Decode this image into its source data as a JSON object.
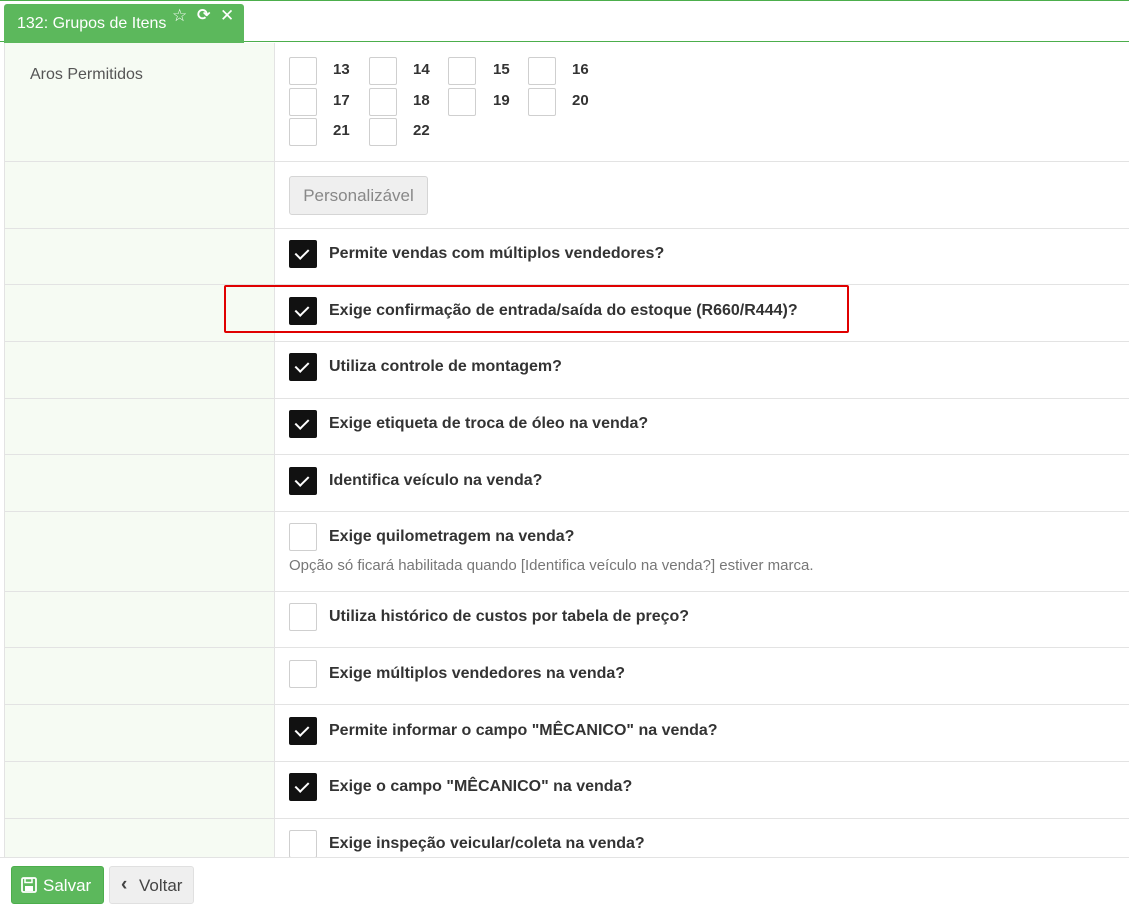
{
  "tab": {
    "title": "132: Grupos de Itens",
    "star_icon": "star-icon",
    "refresh_icon": "refresh-icon",
    "close_icon": "close-icon",
    "color": "#5cb85c"
  },
  "aros": {
    "label": "Aros Permitidos",
    "items": [
      {
        "value": "13",
        "checked": false
      },
      {
        "value": "14",
        "checked": false
      },
      {
        "value": "15",
        "checked": false
      },
      {
        "value": "16",
        "checked": false
      },
      {
        "value": "17",
        "checked": false
      },
      {
        "value": "18",
        "checked": false
      },
      {
        "value": "19",
        "checked": false
      },
      {
        "value": "20",
        "checked": false
      },
      {
        "value": "21",
        "checked": false
      },
      {
        "value": "22",
        "checked": false
      }
    ]
  },
  "personalizavel_button": "Personalizável",
  "options": [
    {
      "label": "Permite vendas com múltiplos vendedores?",
      "checked": true
    },
    {
      "label": "Exige confirmação de entrada/saída do estoque (R660/R444)?",
      "checked": true,
      "highlighted": true
    },
    {
      "label": "Utiliza controle de montagem?",
      "checked": true
    },
    {
      "label": "Exige etiqueta de troca de óleo na venda?",
      "checked": true
    },
    {
      "label": "Identifica veículo na venda?",
      "checked": true
    },
    {
      "label": "Exige quilometragem na venda?",
      "checked": false,
      "hint": "Opção só ficará habilitada quando [Identifica veículo na venda?] estiver marca."
    },
    {
      "label": "Utiliza histórico de custos por tabela de preço?",
      "checked": false
    },
    {
      "label": "Exige múltiplos vendedores na venda?",
      "checked": false
    },
    {
      "label": "Permite informar o campo \"MÊCANICO\" na venda?",
      "checked": true
    },
    {
      "label": "Exige o campo \"MÊCANICO\" na venda?",
      "checked": true
    },
    {
      "label": "Exige inspeção veicular/coleta na venda?",
      "checked": false
    }
  ],
  "footer": {
    "save_label": "Salvar",
    "save_icon": "floppy-disk-icon",
    "back_label": "Voltar",
    "back_icon": "chevron-left-icon"
  },
  "colors": {
    "accent": "#5cb85c",
    "highlight_border": "#e00000",
    "checked_box": "#111111"
  }
}
